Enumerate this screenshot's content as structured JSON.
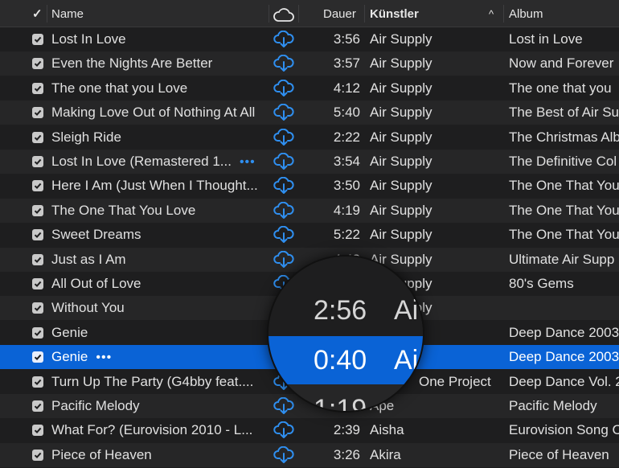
{
  "header": {
    "check_glyph": "✓",
    "name": "Name",
    "cloud_icon": "cloud-icon",
    "dauer": "Dauer",
    "kuenstler": "Künstler",
    "sort_glyph": "^",
    "album": "Album"
  },
  "colors": {
    "accent": "#0a63d6",
    "cloud": "#2f8ff0"
  },
  "rows": [
    {
      "name": "Lost In Love",
      "dauer": "3:56",
      "artist": "Air Supply",
      "album": "Lost in Love",
      "dots": ""
    },
    {
      "name": "Even the Nights Are Better",
      "dauer": "3:57",
      "artist": "Air Supply",
      "album": "Now and Forever",
      "dots": ""
    },
    {
      "name": "The one that you Love",
      "dauer": "4:12",
      "artist": "Air Supply",
      "album": "The one that you",
      "dots": ""
    },
    {
      "name": "Making Love Out of Nothing At All",
      "dauer": "5:40",
      "artist": "Air Supply",
      "album": "The Best of Air Su",
      "dots": ""
    },
    {
      "name": "Sleigh Ride",
      "dauer": "2:22",
      "artist": "Air Supply",
      "album": "The Christmas Alb",
      "dots": ""
    },
    {
      "name": "Lost In Love (Remastered 1...",
      "dauer": "3:54",
      "artist": "Air Supply",
      "album": "The Definitive Col",
      "dots": "•••"
    },
    {
      "name": "Here I Am (Just When I Thought...",
      "dauer": "3:50",
      "artist": "Air Supply",
      "album": "The One That You",
      "dots": ""
    },
    {
      "name": "The One That You Love",
      "dauer": "4:19",
      "artist": "Air Supply",
      "album": "The One That You",
      "dots": ""
    },
    {
      "name": "Sweet Dreams",
      "dauer": "5:22",
      "artist": "Air Supply",
      "album": "The One That You",
      "dots": ""
    },
    {
      "name": "Just as I Am",
      "dauer": "4:43",
      "artist": "Air Supply",
      "album": "Ultimate Air Supp",
      "dots": ""
    },
    {
      "name": "All Out of Love",
      "dauer": "",
      "artist": "Air Supply",
      "album": "80's Gems",
      "dots": ""
    },
    {
      "name": "Without You",
      "dauer": "",
      "artist": "Air Supply",
      "album": "",
      "dots": ""
    },
    {
      "name": "Genie",
      "dauer": "",
      "artist": "",
      "album": "Deep Dance 2003",
      "dots": ""
    },
    {
      "name": "Genie",
      "dauer": "",
      "artist": "",
      "album": "Deep Dance 2003",
      "dots": "•••"
    },
    {
      "name": "Turn Up The Party (G4bby feat....",
      "dauer": "",
      "artist": "One Project",
      "album": "Deep Dance Vol. 2",
      "dots": ""
    },
    {
      "name": "Pacific Melody",
      "dauer": "",
      "artist": "Ape",
      "album": "Pacific Melody",
      "dots": ""
    },
    {
      "name": "What For? (Eurovision 2010 - L...",
      "dauer": "2:39",
      "artist": "Aisha",
      "album": "Eurovision Song C",
      "dots": ""
    },
    {
      "name": "Piece of Heaven",
      "dauer": "3:26",
      "artist": "Akira",
      "album": "Piece of Heaven",
      "dots": ""
    }
  ],
  "magnifier": {
    "top_time": "2:56",
    "top_artist": "Ai",
    "mid_time": "0:40",
    "mid_artist": "Ai",
    "bottom_time": "1:19"
  }
}
